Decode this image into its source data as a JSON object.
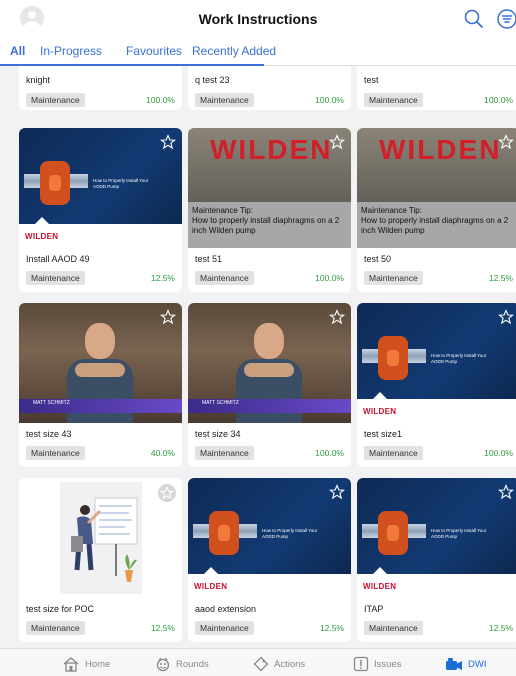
{
  "header": {
    "title": "Work Instructions"
  },
  "tabs": [
    {
      "label": "All",
      "active": true
    },
    {
      "label": "In-Progress",
      "active": false
    },
    {
      "label": "Favourites",
      "active": false
    },
    {
      "label": "Recently Added",
      "active": false
    }
  ],
  "cards": [
    {
      "title": "knight",
      "badge": "Maintenance",
      "progress": "100.0%"
    },
    {
      "title": "q test 23",
      "badge": "Maintenance",
      "progress": "100.0%"
    },
    {
      "title": "test",
      "badge": "Maintenance",
      "progress": "100.0%"
    },
    {
      "title": "Install AAOD 49",
      "badge": "Maintenance",
      "progress": "12.5%",
      "thumb": "pump"
    },
    {
      "title": "test 51",
      "badge": "Maintenance",
      "progress": "100.0%",
      "thumb": "wilden-video",
      "caption": "Maintenance Tip:\nHow to properly install diaphragms on a 2 inch Wilden pump"
    },
    {
      "title": "test 50",
      "badge": "Maintenance",
      "progress": "12.5%",
      "thumb": "wilden-video",
      "caption": "Maintenance Tip:\nHow to properly install diaphragms on a 2 inch Wilden pump"
    },
    {
      "title": "test size 43",
      "badge": "Maintenance",
      "progress": "40.0%",
      "thumb": "video"
    },
    {
      "title": "test size 34",
      "badge": "Maintenance",
      "progress": "100.0%",
      "thumb": "video"
    },
    {
      "title": "test size1",
      "badge": "Maintenance",
      "progress": "100.0%",
      "thumb": "pump"
    },
    {
      "title": "test size for POC",
      "badge": "Maintenance",
      "progress": "12.5%",
      "thumb": "illustration"
    },
    {
      "title": "aaod extension",
      "badge": "Maintenance",
      "progress": "12.5%",
      "thumb": "pump"
    },
    {
      "title": "ITAP",
      "badge": "Maintenance",
      "progress": "12.5%",
      "thumb": "pump"
    }
  ],
  "thumb_text": {
    "pump_caption": "How to Properly Install Your AODD Pump",
    "wilden_logo": "WILDEN",
    "video_name": "MATT SCHMITZ"
  },
  "bottom_nav": [
    {
      "label": "Home",
      "icon": "home-icon",
      "active": false
    },
    {
      "label": "Rounds",
      "icon": "rounds-icon",
      "active": false
    },
    {
      "label": "Actions",
      "icon": "tag-icon",
      "active": false
    },
    {
      "label": "Issues",
      "icon": "issues-icon",
      "active": false
    },
    {
      "label": "DWI",
      "icon": "dwi-icon",
      "active": true
    }
  ],
  "colors": {
    "accent": "#3b6fd9",
    "progress": "#2e9b3e",
    "nav_active": "#1a6fd6"
  }
}
